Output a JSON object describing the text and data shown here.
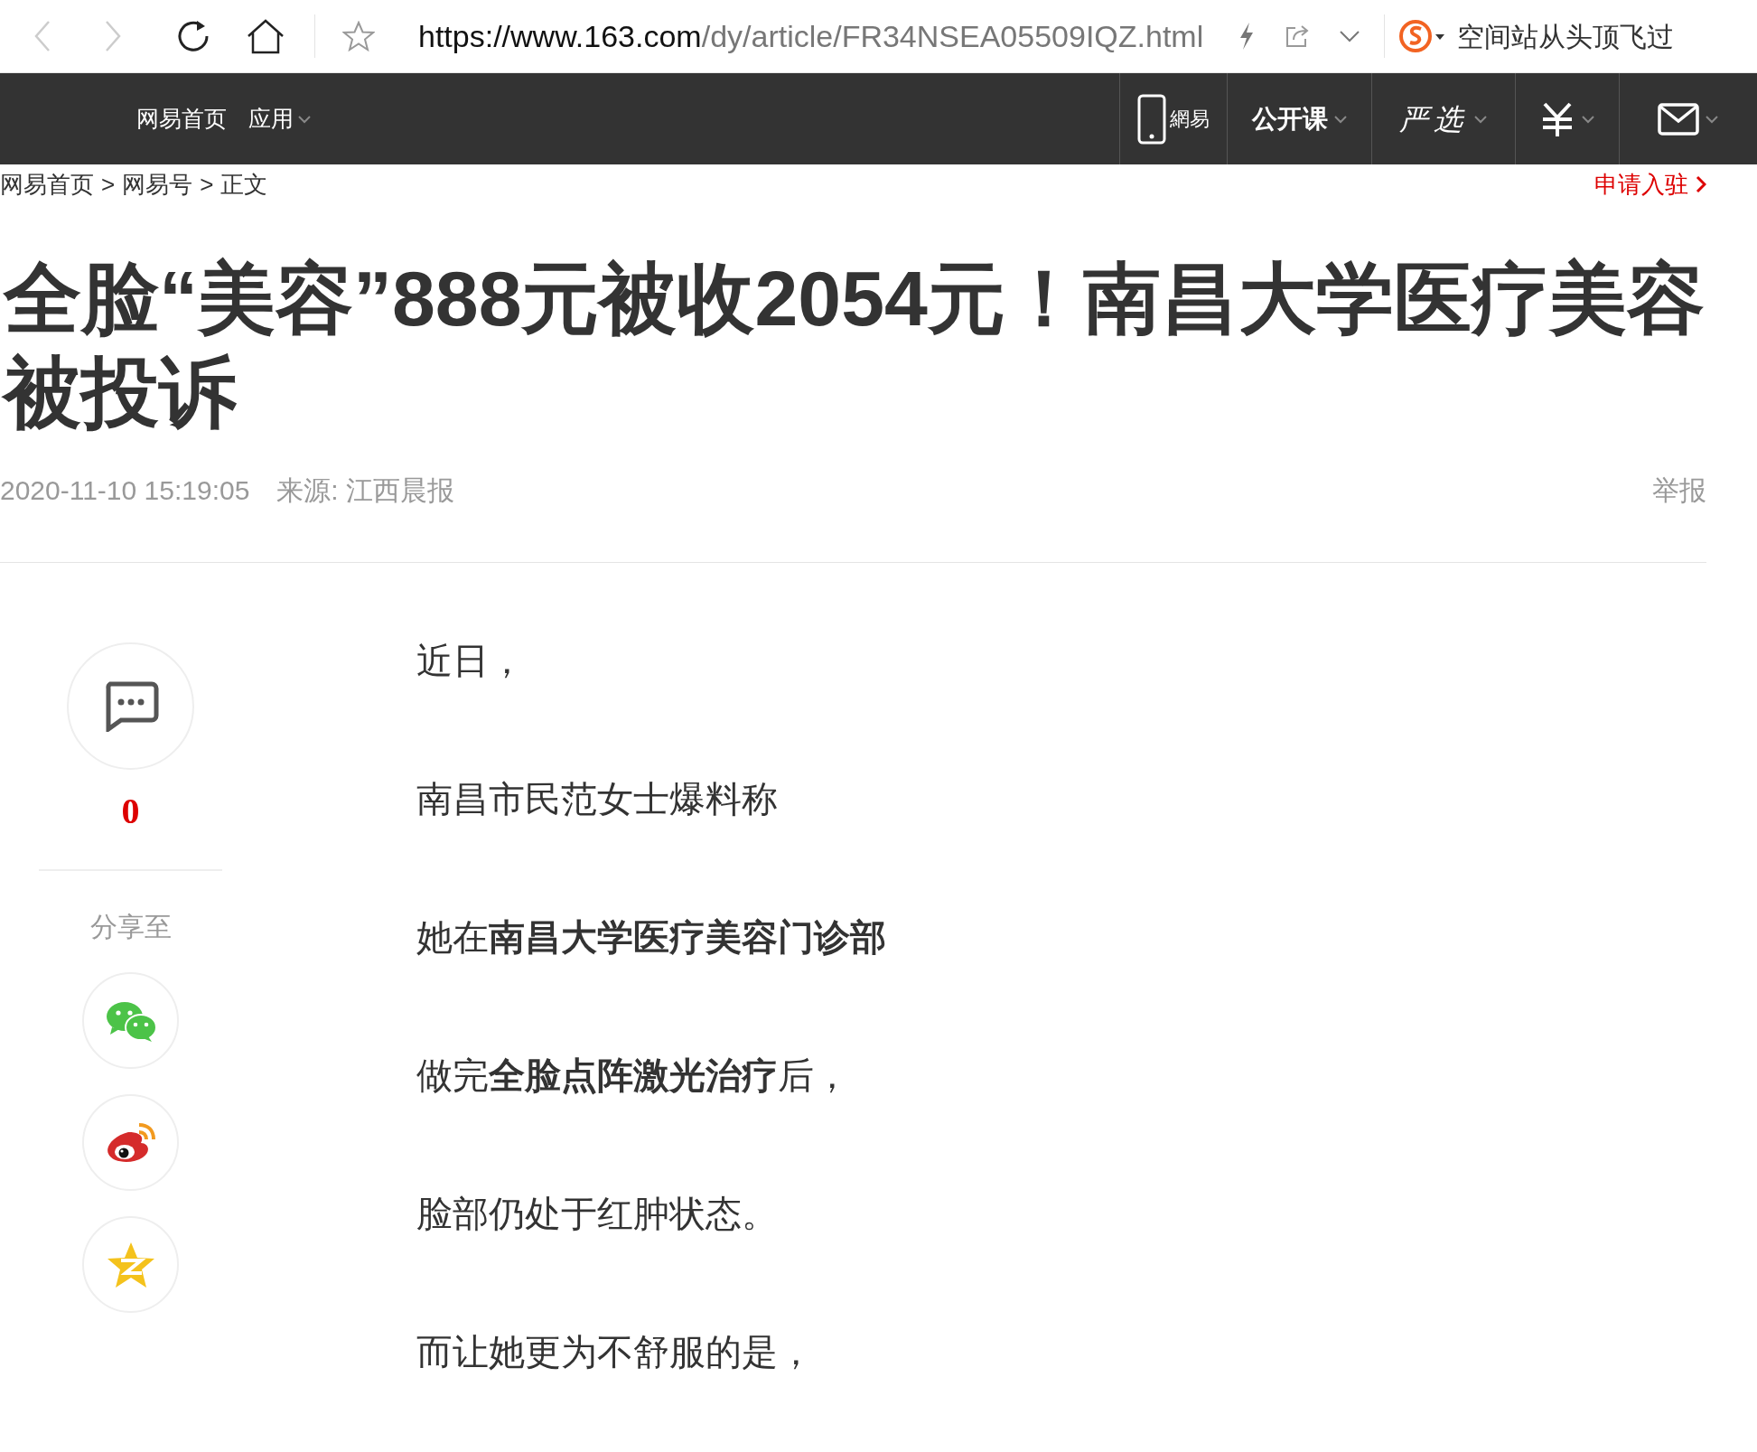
{
  "browser": {
    "url_host": "https://www.163.com",
    "url_path": "/dy/article/FR34NSEA05509IQZ.html",
    "search_hint": "空间站从头顶飞过"
  },
  "nav": {
    "left": [
      {
        "label": "网易首页",
        "dropdown": false
      },
      {
        "label": "应用",
        "dropdown": true
      }
    ],
    "right": [
      {
        "kind": "phone-logo",
        "label": "網易"
      },
      {
        "kind": "text",
        "label": "公开课"
      },
      {
        "kind": "script",
        "label": "严选"
      },
      {
        "kind": "yen"
      },
      {
        "kind": "mail"
      }
    ]
  },
  "breadcrumb": [
    "网易首页",
    "网易号",
    "正文"
  ],
  "breadcrumb_separator": ">",
  "apply_link": "申请入驻",
  "title": "全脸“美容”888元被收2054元！南昌大学医疗美容被投诉",
  "meta": {
    "time": "2020-11-10 15:19:05",
    "source": "来源: 江西晨报",
    "report": "举报"
  },
  "sidebar": {
    "comment_count": "0",
    "share_label": "分享至",
    "share": [
      {
        "kind": "wechat"
      },
      {
        "kind": "weibo"
      },
      {
        "kind": "qzone"
      }
    ]
  },
  "paragraphs": [
    "近日，",
    "南昌市民范女士爆料称",
    "她在**南昌大学医疗美容门诊部**",
    "做完**全脸点阵激光治疗**后，",
    "脸部仍处于红肿状态。",
    "而让她更为不舒服的是，"
  ]
}
